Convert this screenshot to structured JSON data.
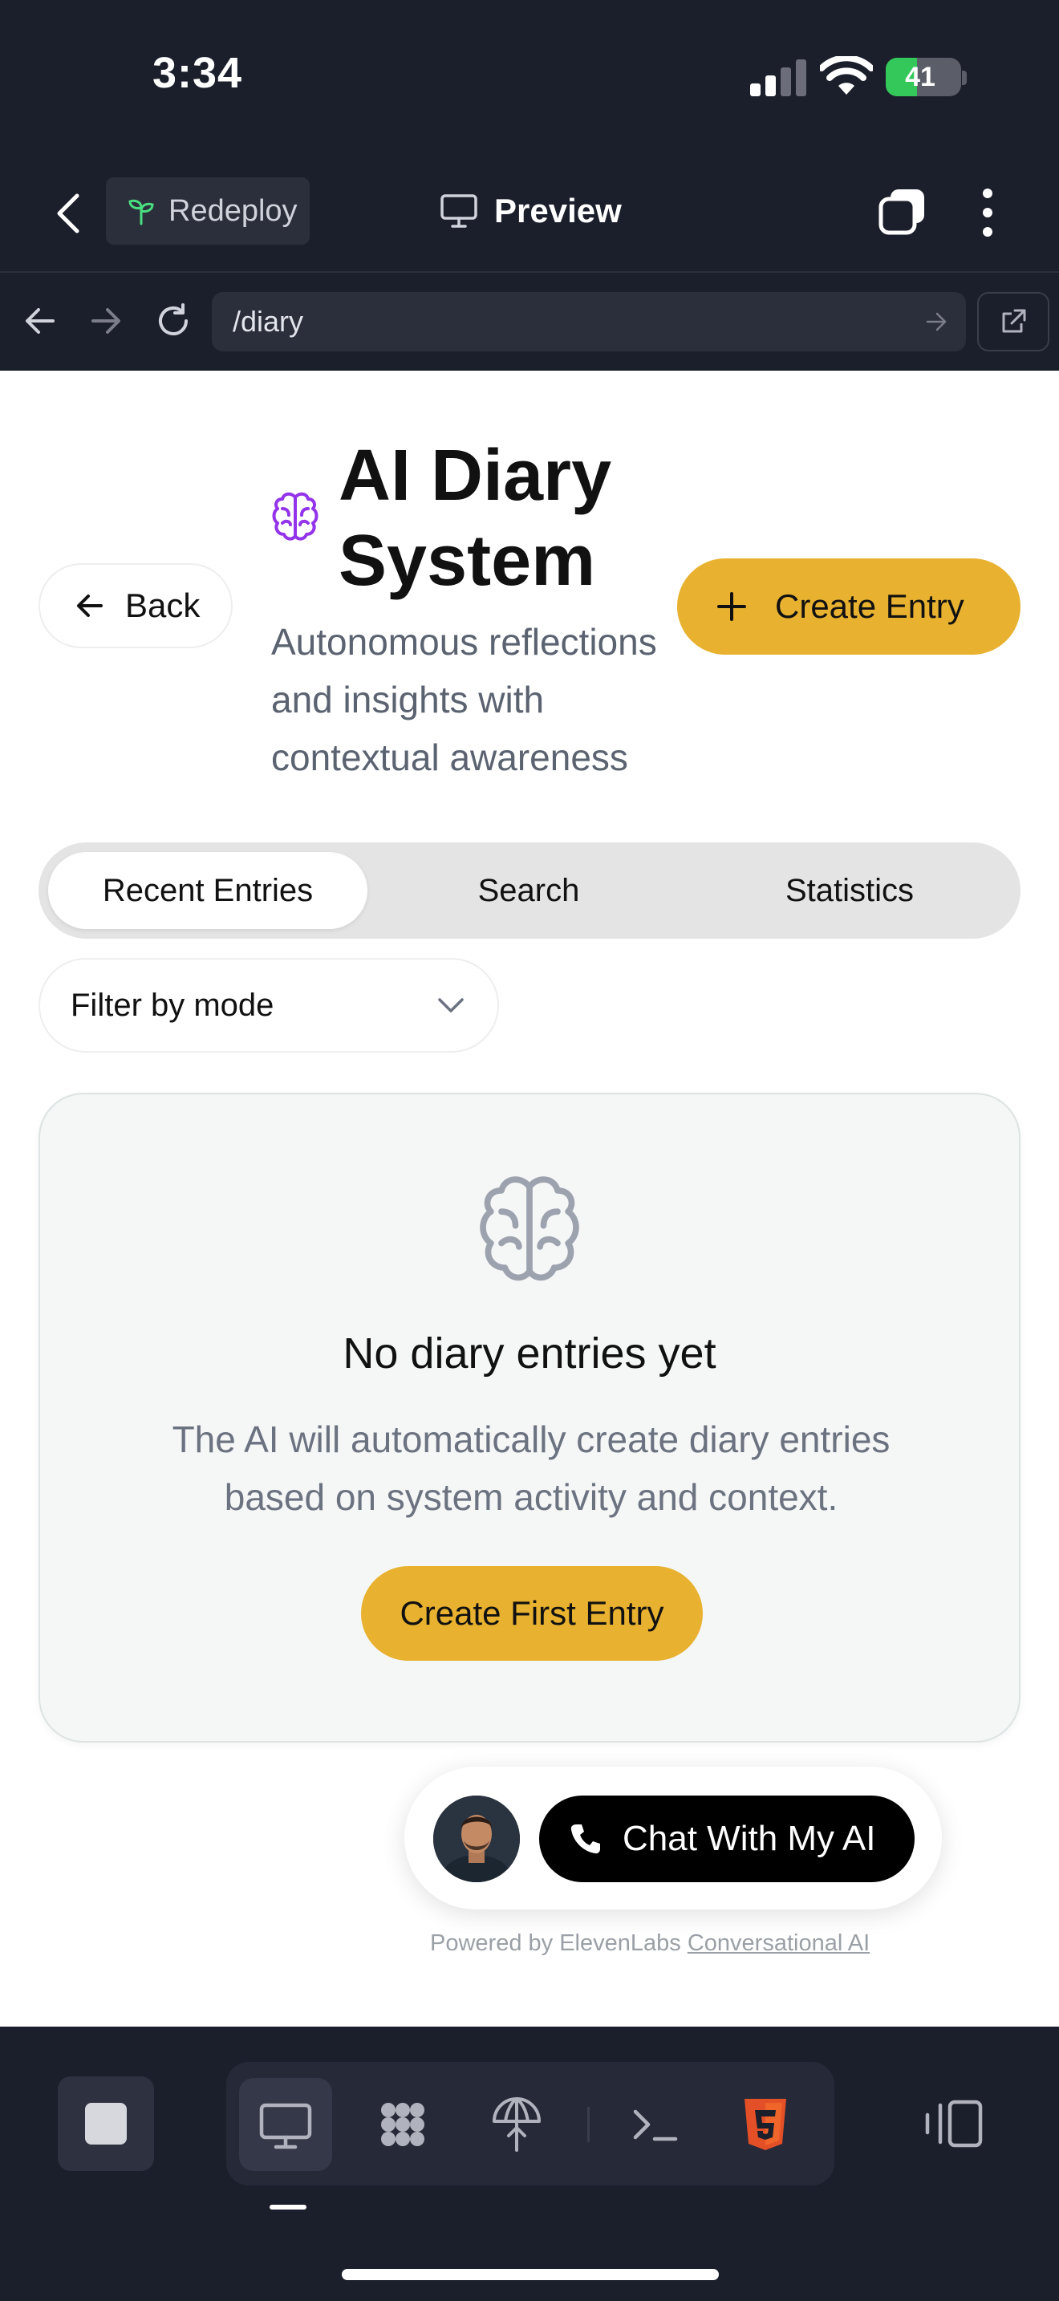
{
  "status": {
    "time": "3:34",
    "battery": "41",
    "battery_level": 0.41
  },
  "header": {
    "redeploy_label": "Redeploy",
    "preview_label": "Preview"
  },
  "urlbar": {
    "url": "/diary"
  },
  "page": {
    "back_label": "Back",
    "title": "AI Diary System",
    "subtitle": "Autonomous reflections and insights with contextual awareness",
    "create_label": "Create Entry",
    "tabs": [
      {
        "label": "Recent Entries",
        "active": true
      },
      {
        "label": "Search",
        "active": false
      },
      {
        "label": "Statistics",
        "active": false
      }
    ],
    "filter_label": "Filter by mode",
    "empty": {
      "title": "No diary entries yet",
      "description": "The AI will automatically create diary entries based on system activity and context.",
      "button_label": "Create First Entry"
    },
    "chat_widget": {
      "button_label": "Chat With My AI",
      "powered_prefix": "Powered by ElevenLabs",
      "powered_link": "Conversational AI"
    }
  },
  "colors": {
    "accent": "#e8b130",
    "brain_icon": "#9333ea",
    "chrome": "#1b1e2b"
  },
  "icons": [
    "chevron-left-icon",
    "sprout-icon",
    "monitor-icon",
    "tabs-icon",
    "more-vertical-icon",
    "arrow-left-icon",
    "arrow-right-icon",
    "reload-icon",
    "external-link-icon",
    "brain-icon",
    "plus-icon",
    "chevron-down-icon",
    "phone-icon",
    "stop-icon",
    "grid-icon",
    "terminal-icon",
    "html5-icon",
    "panel-icon"
  ]
}
